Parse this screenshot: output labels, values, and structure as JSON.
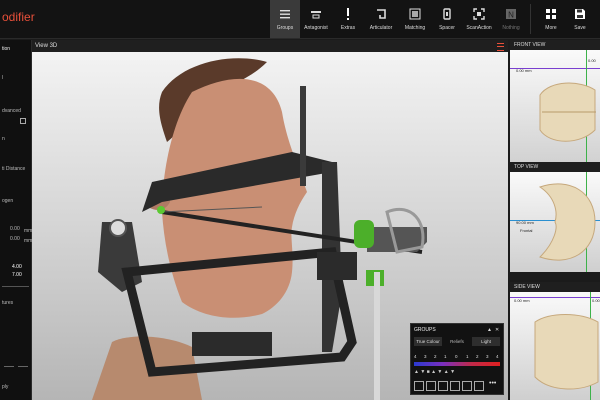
{
  "app": {
    "title": "odifier"
  },
  "toolbar": {
    "items": [
      {
        "label": "Groups"
      },
      {
        "label": "Antagonist"
      },
      {
        "label": "Extras"
      },
      {
        "label": "Articulator"
      },
      {
        "label": "Matching"
      },
      {
        "label": "Spacer"
      },
      {
        "label": "ScanAction"
      },
      {
        "label": "Nothing"
      }
    ],
    "more": "More",
    "save": "Save"
  },
  "left_panel": {
    "texts": [
      "tion",
      "l",
      "dvanced",
      "n",
      "ti Distance",
      "ogen",
      "0.00",
      "0.00",
      "mm",
      "mm",
      "4.00",
      "7.00",
      "tures",
      "ply"
    ]
  },
  "view3d": {
    "title": "View 3D"
  },
  "right": {
    "front": {
      "title": "FRONT VIEW",
      "value1": "0.00 mm",
      "value2": "0.00"
    },
    "top": {
      "title": "TOP VIEW",
      "value1": "90.00 mm",
      "value2": "Frontal"
    },
    "side": {
      "title": "SIDE VIEW",
      "value1": "0.00 mm",
      "value2": "0.00"
    }
  },
  "groups": {
    "title": "GROUPS",
    "buttons": [
      "True Colour",
      "Reliefs",
      "Light"
    ],
    "scale": [
      "4",
      "3",
      "2",
      "1",
      "0",
      "1",
      "2",
      "3",
      "4"
    ]
  },
  "colors": {
    "accent": "#e8503a",
    "green": "#4caf2a"
  }
}
